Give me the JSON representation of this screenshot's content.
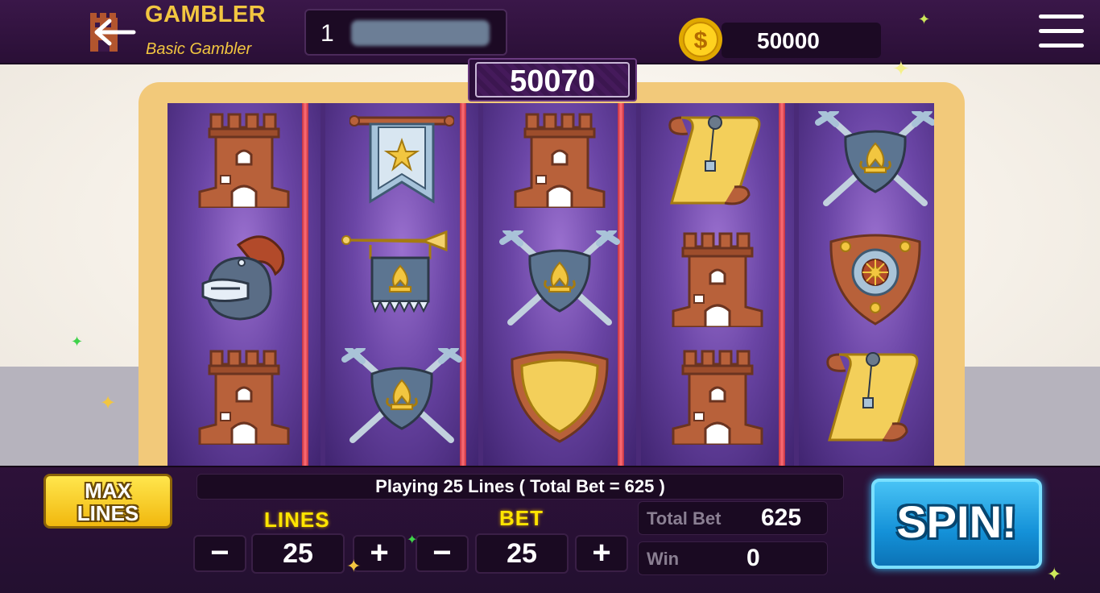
{
  "header": {
    "title": "GAMBLER",
    "subtitle": "Basic Gambler",
    "level": "1",
    "coins": "50000"
  },
  "jackpot": "50070",
  "reels": [
    [
      "tower-icon",
      "helmet-icon",
      "tower-icon"
    ],
    [
      "banner-icon",
      "trumpet-banner-icon",
      "crossed-swords-shield-icon"
    ],
    [
      "tower-icon",
      "crossed-swords-shield-icon",
      "gold-shield-icon"
    ],
    [
      "scroll-icon",
      "tower-icon",
      "tower-icon"
    ],
    [
      "crossed-swords-shield-icon",
      "round-shield-icon",
      "scroll-icon"
    ]
  ],
  "controls": {
    "max_lines_label_1": "MAX",
    "max_lines_label_2": "LINES",
    "status_text": "Playing 25 Lines ( Total Bet = 625 )",
    "lines_label": "LINES",
    "lines_value": "25",
    "bet_label": "BET",
    "bet_value": "25",
    "minus": "−",
    "plus": "+",
    "total_bet_label": "Total Bet",
    "total_bet_value": "625",
    "win_label": "Win",
    "win_value": "0",
    "spin_label": "SPIN!"
  },
  "colors": {
    "accent_gold": "#f2c640",
    "spin_blue": "#1491d8",
    "reel_purple": "#6a45a5",
    "divider_red": "#ff6f76"
  }
}
